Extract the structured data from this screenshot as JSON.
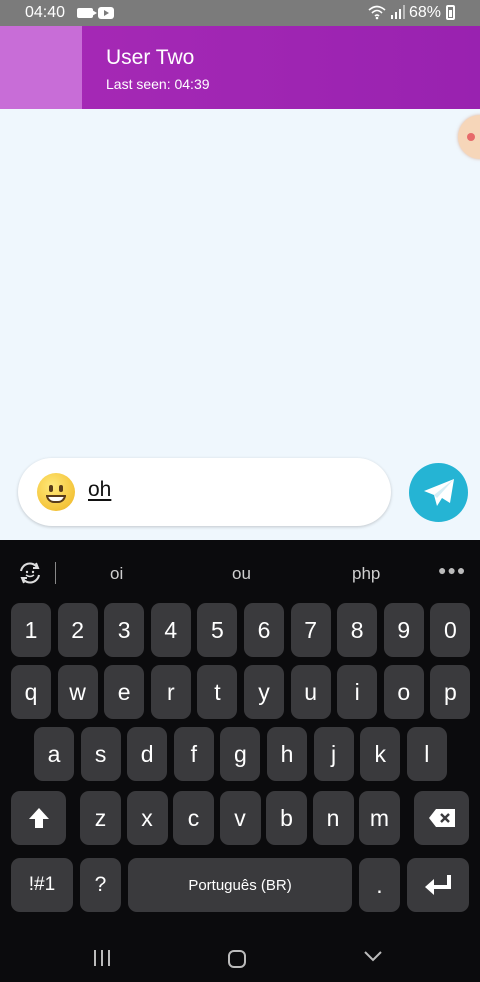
{
  "status_bar": {
    "time": "04:40",
    "battery": "68%",
    "icons": [
      "video-icon",
      "youtube-icon",
      "wifi-icon",
      "signal-icon",
      "battery-icon"
    ]
  },
  "header": {
    "title": "User Two",
    "subtitle": "Last seen: 04:39"
  },
  "composer": {
    "text": "oh",
    "emoji_icon": "grinning-face-icon",
    "send_icon": "paper-plane-icon"
  },
  "keyboard": {
    "suggestions": [
      "oi",
      "ou",
      "php"
    ],
    "rows": {
      "numbers": [
        "1",
        "2",
        "3",
        "4",
        "5",
        "6",
        "7",
        "8",
        "9",
        "0"
      ],
      "row1": [
        "q",
        "w",
        "e",
        "r",
        "t",
        "y",
        "u",
        "i",
        "o",
        "p"
      ],
      "row2": [
        "a",
        "s",
        "d",
        "f",
        "g",
        "h",
        "j",
        "k",
        "l"
      ],
      "row3": [
        "z",
        "x",
        "c",
        "v",
        "b",
        "n",
        "m"
      ]
    },
    "symbols_label": "!#1",
    "question_label": "?",
    "space_label": "Português (BR)",
    "period_label": "."
  },
  "colors": {
    "header": "#9922b0",
    "avatar": "#c86dd7",
    "background": "#eff7fd",
    "send_button": "#25b4d4",
    "keyboard": "#0b0b0d",
    "key": "#3a3a3d"
  }
}
